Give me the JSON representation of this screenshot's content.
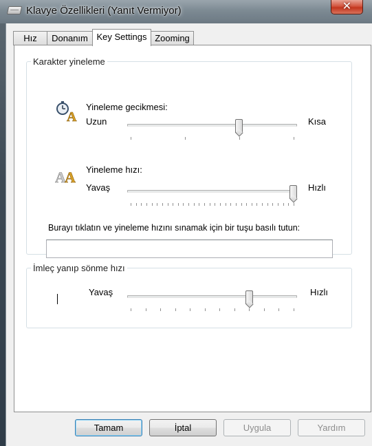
{
  "window": {
    "title": "Klavye Özellikleri (Yanıt Vermiyor)",
    "close_glyph": "✕"
  },
  "tabs": [
    {
      "label": "Hız",
      "active": false
    },
    {
      "label": "Donanım",
      "active": false
    },
    {
      "label": "Key Settings",
      "active": true
    },
    {
      "label": "Zooming",
      "active": false
    }
  ],
  "repeat_group": {
    "title": "Karakter yineleme",
    "delay": {
      "icon": "repeat-delay-icon",
      "label": "Yineleme gecikmesi:",
      "min_label": "Uzun",
      "max_label": "Kısa",
      "value": 2,
      "min": 0,
      "max": 3
    },
    "rate": {
      "icon": "repeat-rate-icon",
      "label": "Yineleme hızı:",
      "min_label": "Yavaş",
      "max_label": "Hızlı",
      "value": 31,
      "min": 0,
      "max": 31
    },
    "test_prompt": "Burayı tıklatın ve yineleme hızını sınamak için bir tuşu basılı tutun:",
    "test_value": ""
  },
  "cursor_group": {
    "title": "İmleç yanıp sönme hızı",
    "min_label": "Yavaş",
    "max_label": "Hızlı",
    "value": 8,
    "min": 0,
    "max": 11
  },
  "buttons": {
    "ok": "Tamam",
    "cancel": "İptal",
    "apply": "Uygula",
    "help": "Yardım"
  },
  "colors": {
    "close_button": "#c3361e",
    "default_button_border": "#3c7fb1"
  }
}
